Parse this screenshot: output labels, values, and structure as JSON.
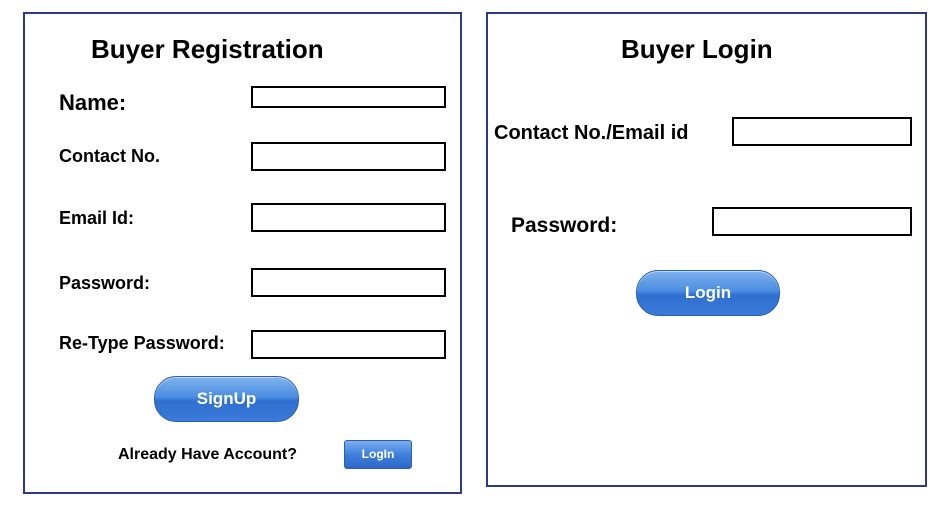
{
  "registration": {
    "title": "Buyer Registration",
    "name_label": "Name:",
    "contact_label": "Contact No.",
    "email_label": "Email Id:",
    "password_label": "Password:",
    "retype_label": "Re-Type Password:",
    "signup_button": "SignUp",
    "already_text": "Already Have Account?",
    "login_link_button": "LogIn"
  },
  "login": {
    "title": "Buyer Login",
    "contact_email_label": "Contact No./Email id",
    "password_label": "Password:",
    "login_button": "Login"
  },
  "colors": {
    "panel_border": "#2b3a8c",
    "button_blue": "#3a7bd8"
  }
}
